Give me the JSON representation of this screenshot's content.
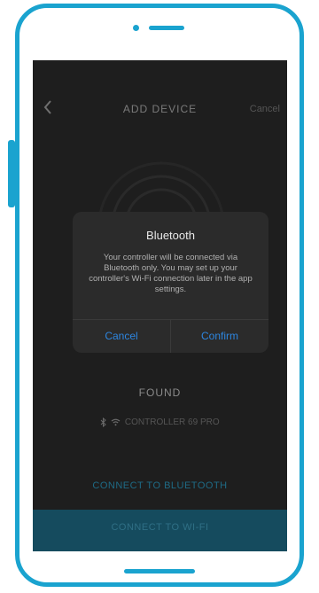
{
  "nav": {
    "title": "ADD DEVICE",
    "cancel": "Cancel"
  },
  "status": {
    "found": "FOUND",
    "device_name": "CONTROLLER 69 PRO"
  },
  "actions": {
    "connect_bluetooth": "CONNECT TO BLUETOOTH",
    "connect_wifi": "CONNECT TO WI-FI"
  },
  "dialog": {
    "title": "Bluetooth",
    "message": "Your controller will be connected via Bluetooth only. You may set up your controller's Wi-Fi connection later in the app settings.",
    "cancel": "Cancel",
    "confirm": "Confirm"
  },
  "colors": {
    "frame": "#1aa3cf",
    "screen_bg": "#1e1e1e",
    "dialog_bg": "#2b2b2b",
    "dialog_button": "#2d86e0",
    "wifi_bar": "#154b5e"
  },
  "icons": {
    "back": "chevron-left-icon",
    "bluetooth": "bluetooth-icon",
    "wifi": "wifi-icon",
    "radar": "radar-rings-icon"
  }
}
